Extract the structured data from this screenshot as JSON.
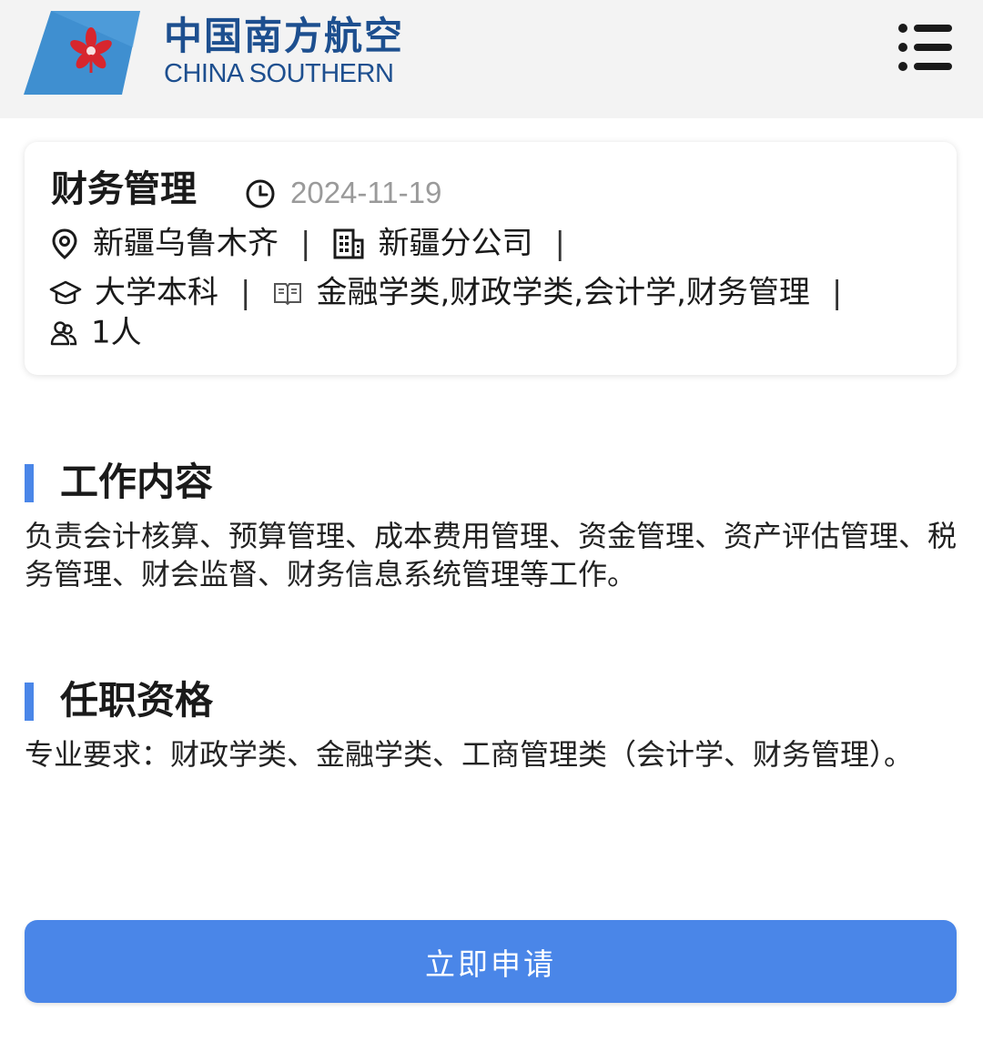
{
  "header": {
    "brand_cn": "中国南方航空",
    "brand_en": "CHINA SOUTHERN",
    "logo_icon": "china-southern-kapok-logo",
    "menu_icon": "menu-icon",
    "brand_color": "#1d4f8f"
  },
  "job": {
    "title": "财务管理",
    "date": "2024-11-19",
    "location": "新疆乌鲁木齐",
    "company": "新疆分公司",
    "education": "大学本科",
    "majors": "金融学类,财政学类,会计学,财务管理",
    "headcount": "1人",
    "separator": "|"
  },
  "sections": {
    "content": {
      "title": "工作内容",
      "body": "负责会计核算、预算管理、成本费用管理、资金管理、资产评估管理、税务管理、财会监督、财务信息系统管理等工作。"
    },
    "qualification": {
      "title": "任职资格",
      "body": "专业要求：财政学类、金融学类、工商管理类（会计学、财务管理）。"
    }
  },
  "apply_button": {
    "label": "立即申请",
    "color": "#4a86e8"
  }
}
